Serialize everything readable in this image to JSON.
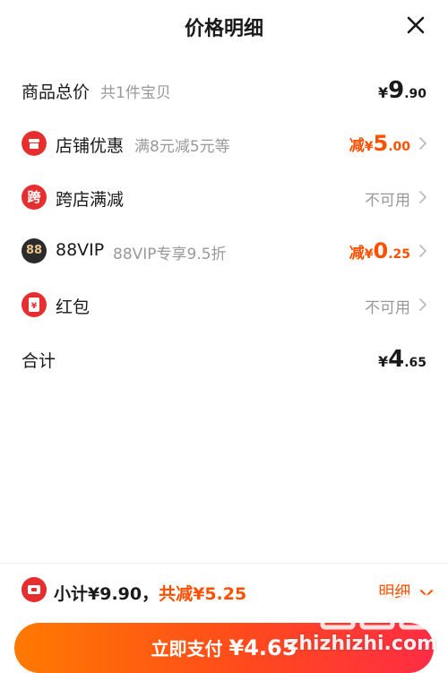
{
  "header": {
    "title": "价格明细"
  },
  "rows": {
    "total": {
      "label": "商品总价",
      "sub": "共1件宝贝",
      "yen": "¥",
      "int": "9",
      "dec": ".90"
    },
    "shop": {
      "label": "店铺优惠",
      "sub": "满8元减5元等",
      "prefix": "减",
      "yen": "¥",
      "int": "5",
      "dec": ".00"
    },
    "cross": {
      "label": "跨店满减",
      "icon_char": "跨",
      "status": "不可用"
    },
    "vip": {
      "label": "88VIP",
      "icon_char": "88",
      "sub": "88VIP专享9.5折",
      "prefix": "减",
      "yen": "¥",
      "int": "0",
      "dec": ".25"
    },
    "redpacket": {
      "label": "红包",
      "icon_char": "¥",
      "status": "不可用"
    },
    "sum": {
      "label": "合计",
      "yen": "¥",
      "int": "4",
      "dec": ".65"
    }
  },
  "footer": {
    "subtotal_label": "小计¥9.90，",
    "saved_label": "共减¥5.25",
    "detail_label": "明细",
    "pay_label": "立即支付",
    "pay_amount": "¥4.65"
  },
  "watermark": {
    "text": "zhizhizhi.com"
  },
  "colors": {
    "accent": "#ff5000",
    "muted": "#999999",
    "red_icon": "#e62e2e",
    "vip_icon": "#2b2b2b"
  }
}
